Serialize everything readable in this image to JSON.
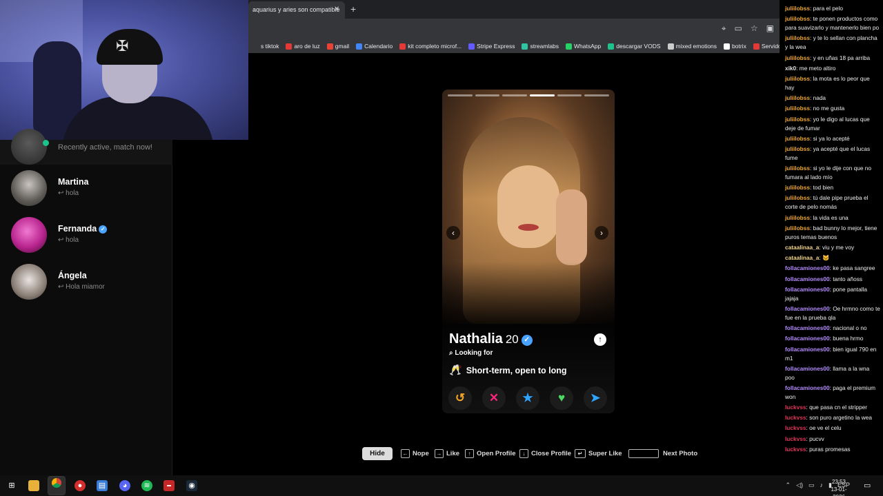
{
  "browser": {
    "tab_title": "aquarius y aries son compatible",
    "tab_close": "✕",
    "new_tab": "+",
    "bookmarks": [
      {
        "label": "s tiktok",
        "color": "#35363a"
      },
      {
        "label": "aro de luz",
        "color": "#e53935"
      },
      {
        "label": "gmail",
        "color": "#ea4335"
      },
      {
        "label": "Calendario",
        "color": "#4285f4"
      },
      {
        "label": "kit completo microf...",
        "color": "#e53935"
      },
      {
        "label": "Stripe Express",
        "color": "#635bff"
      },
      {
        "label": "streamlabs",
        "color": "#31c3a2"
      },
      {
        "label": "WhatsApp",
        "color": "#25d366"
      },
      {
        "label": "descargar VODS",
        "color": "#1ec28b"
      },
      {
        "label": "mixed emotions",
        "color": "#cccccc"
      },
      {
        "label": "botrix",
        "color": "#ffffff"
      },
      {
        "label": "Servidor IRL",
        "color": "#e53935"
      }
    ]
  },
  "sidebar": {
    "recent_text": "Recently active, match now!",
    "matches": [
      {
        "name": "Martina",
        "last_message": "↩ hola",
        "verified": false
      },
      {
        "name": "Fernanda",
        "last_message": "↩ hola",
        "verified": true
      },
      {
        "name": "Ángela",
        "last_message": "↩ Hola miamor",
        "verified": false
      }
    ]
  },
  "profile": {
    "name": "Nathalia",
    "age": "20",
    "verified_icon": "✓",
    "looking_for_label": "Looking for",
    "intent": "Short-term, open to long",
    "intent_icon": "🥂",
    "photo_count": 6,
    "active_photo": 4,
    "arrow_prev": "‹",
    "arrow_next": "›",
    "expand_icon": "↑"
  },
  "actions": {
    "rewind": {
      "icon": "↺",
      "color": "#f5a623"
    },
    "nope": {
      "icon": "✕",
      "color": "#fd267d"
    },
    "super_like": {
      "icon": "★",
      "color": "#2ea6ff"
    },
    "like": {
      "icon": "♥",
      "color": "#4cd964"
    },
    "boost": {
      "icon": "➤",
      "color": "#2ea6ff"
    }
  },
  "hints": {
    "hide": "Hide",
    "nope": "Nope",
    "like": "Like",
    "open_profile": "Open Profile",
    "close_profile": "Close Profile",
    "super_like": "Super Like",
    "next_photo": "Next Photo",
    "key_left": "←",
    "key_right": "→",
    "key_up": "↑",
    "key_down": "↓",
    "key_enter": "↵"
  },
  "chat": {
    "messages": [
      {
        "user": "juliilobss",
        "text": "para el pelo",
        "color": "#f0a830"
      },
      {
        "user": "juliilobss",
        "text": "te ponen productos como para suavizarlo y mantenerlo bien po",
        "color": "#f0a830"
      },
      {
        "user": "juliilobss",
        "text": "y te lo sellan con plancha y la wea",
        "color": "#f0a830"
      },
      {
        "user": "juliilobss",
        "text": "y en uñas 18 pa arriba",
        "color": "#f0a830"
      },
      {
        "user": "xik0",
        "text": "me meto altiro",
        "color": "#e0e0e0"
      },
      {
        "user": "juliilobss",
        "text": "la mota es lo peor que hay",
        "color": "#f0a830"
      },
      {
        "user": "juliilobss",
        "text": "nada",
        "color": "#f0a830"
      },
      {
        "user": "juliilobss",
        "text": "no me gusta",
        "color": "#f0a830"
      },
      {
        "user": "juliilobss",
        "text": "yo le digo al lucas que deje de fumar",
        "color": "#f0a830"
      },
      {
        "user": "juliilobss",
        "text": "si ya lo acepté",
        "color": "#f0a830"
      },
      {
        "user": "juliilobss",
        "text": "ya acepté que el lucas fume",
        "color": "#f0a830"
      },
      {
        "user": "juliilobss",
        "text": "si yo le dije con que no fumara al lado mío",
        "color": "#f0a830"
      },
      {
        "user": "juliilobss",
        "text": "tod bien",
        "color": "#f0a830"
      },
      {
        "user": "juliilobss",
        "text": "tú dale pipe prueba el corte de pelo nomás",
        "color": "#f0a830"
      },
      {
        "user": "juliilobss",
        "text": "la vida es una",
        "color": "#f0a830"
      },
      {
        "user": "juliilobss",
        "text": "bad bunny lo mejor, tiene puros temas buenos",
        "color": "#f0a830"
      },
      {
        "user": "cataalinaa_a",
        "text": "viu y me voy",
        "color": "#f5d78a"
      },
      {
        "user": "cataalinaa_a",
        "text": "🐱",
        "color": "#f5d78a"
      },
      {
        "user": "follacamiones00",
        "text": "ke pasa sangree",
        "color": "#b48cff"
      },
      {
        "user": "follacamiones00",
        "text": "tanto añoss",
        "color": "#b48cff"
      },
      {
        "user": "follacamiones00",
        "text": "pone pantalla jajaja",
        "color": "#b48cff"
      },
      {
        "user": "follacamiones00",
        "text": "Oe hrmno como te fue en la prueba qla",
        "color": "#b48cff"
      },
      {
        "user": "follacamiones00",
        "text": "nacional o no",
        "color": "#b48cff"
      },
      {
        "user": "follacamiones00",
        "text": "buena hrmo",
        "color": "#b48cff"
      },
      {
        "user": "follacamiones00",
        "text": "bien igual 790 en m1",
        "color": "#b48cff"
      },
      {
        "user": "follacamiones00",
        "text": "llama a la wna poo",
        "color": "#b48cff"
      },
      {
        "user": "follacamiones00",
        "text": "paga el premium won",
        "color": "#b48cff"
      },
      {
        "user": "luckvss",
        "text": "que pasa cn el stripper",
        "color": "#e2365a"
      },
      {
        "user": "luckvss",
        "text": "son puro argetino la wea",
        "color": "#e2365a"
      },
      {
        "user": "luckvss",
        "text": "oe ve el celu",
        "color": "#e2365a"
      },
      {
        "user": "luckvss",
        "text": "pucvv",
        "color": "#e2365a"
      },
      {
        "user": "luckvss",
        "text": "puras promesas",
        "color": "#e2365a"
      }
    ]
  },
  "taskbar": {
    "language": "ESP",
    "time": "23:53",
    "date": "13-01-2026"
  }
}
